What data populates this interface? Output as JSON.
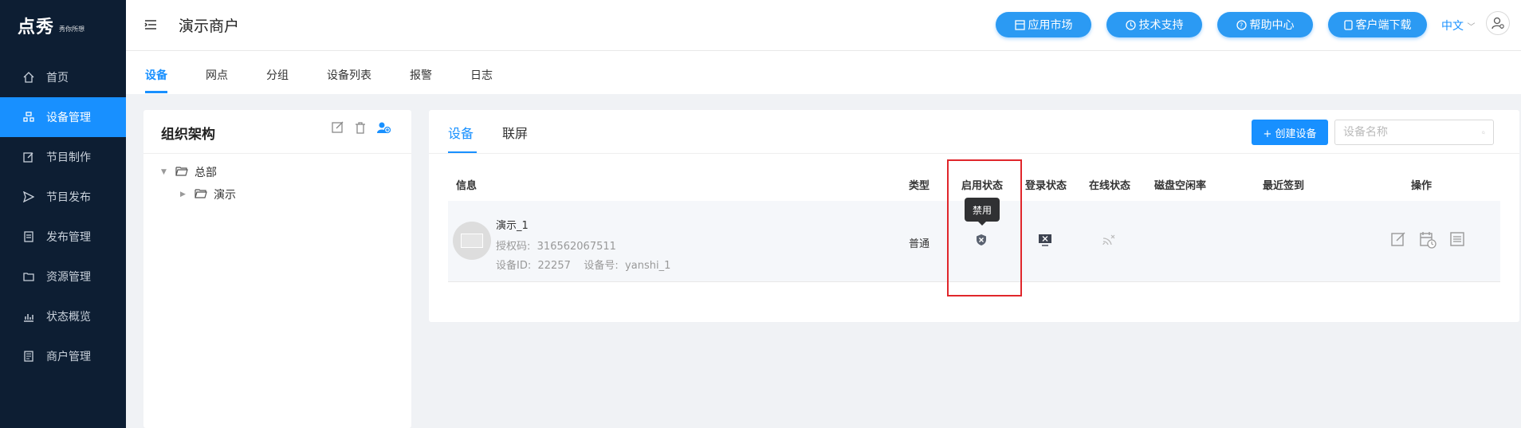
{
  "app": {
    "logo_text": "点秀",
    "logo_sub": "秀你所想"
  },
  "sidebar": {
    "items": [
      {
        "label": "首页",
        "icon": "home-icon"
      },
      {
        "label": "设备管理",
        "icon": "device-icon",
        "active": true
      },
      {
        "label": "节目制作",
        "icon": "edit-icon"
      },
      {
        "label": "节目发布",
        "icon": "send-icon"
      },
      {
        "label": "发布管理",
        "icon": "list-icon"
      },
      {
        "label": "资源管理",
        "icon": "folder-icon"
      },
      {
        "label": "状态概览",
        "icon": "chart-icon"
      },
      {
        "label": "商户管理",
        "icon": "doc-icon"
      }
    ]
  },
  "header": {
    "title": "演示商户",
    "buttons": [
      "应用市场",
      "技术支持",
      "帮助中心",
      "客户端下载"
    ],
    "language": "中文"
  },
  "subnav": {
    "tabs": [
      "设备",
      "网点",
      "分组",
      "设备列表",
      "报警",
      "日志"
    ]
  },
  "org": {
    "title": "组织架构",
    "root": "总部",
    "child": "演示"
  },
  "devices": {
    "tabs": [
      "设备",
      "联屏"
    ],
    "create_label": "+ 创建设备",
    "search_placeholder": "设备名称",
    "columns": [
      "信息",
      "类型",
      "启用状态",
      "登录状态",
      "在线状态",
      "磁盘空闲率",
      "最近签到",
      "操作"
    ],
    "rows": [
      {
        "name": "演示_1",
        "auth_label": "授权码:",
        "auth_code": "316562067511",
        "id_label": "设备ID:",
        "device_id": "22257",
        "num_label": "设备号:",
        "device_no": "yanshi_1",
        "type": "普通",
        "enable_tooltip": "禁用"
      }
    ]
  },
  "colors": {
    "sidebar_bg": "#0d1e33",
    "accent": "#1890ff",
    "highlight": "#e0262b"
  }
}
